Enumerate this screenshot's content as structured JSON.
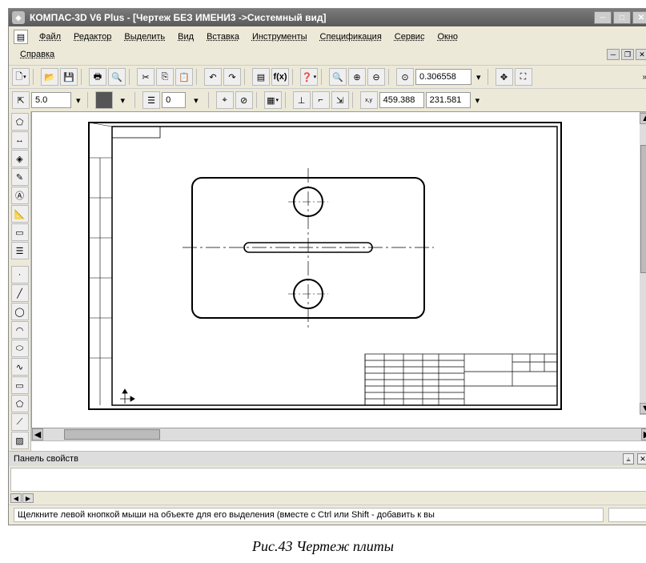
{
  "title": "КОМПАС-3D V6 Plus - [Чертеж БЕЗ ИМЕНИ3 ->Системный вид]",
  "menus": {
    "file": "Файл",
    "editor": "Редактор",
    "select": "Выделить",
    "view": "Вид",
    "insert": "Вставка",
    "tools": "Инструменты",
    "spec": "Спецификация",
    "service": "Сервис",
    "window": "Окно",
    "help": "Справка"
  },
  "toolbar1": {
    "zoom": "0.306558"
  },
  "toolbar2": {
    "step": "5.0",
    "layer": "0",
    "coordX": "459.388",
    "coordY": "231.581"
  },
  "properties_title": "Панель свойств",
  "status": "Щелкните левой кнопкой мыши на объекте для его выделения (вместе с Ctrl или Shift - добавить к вы",
  "caption": "Рис.43 Чертеж плиты"
}
